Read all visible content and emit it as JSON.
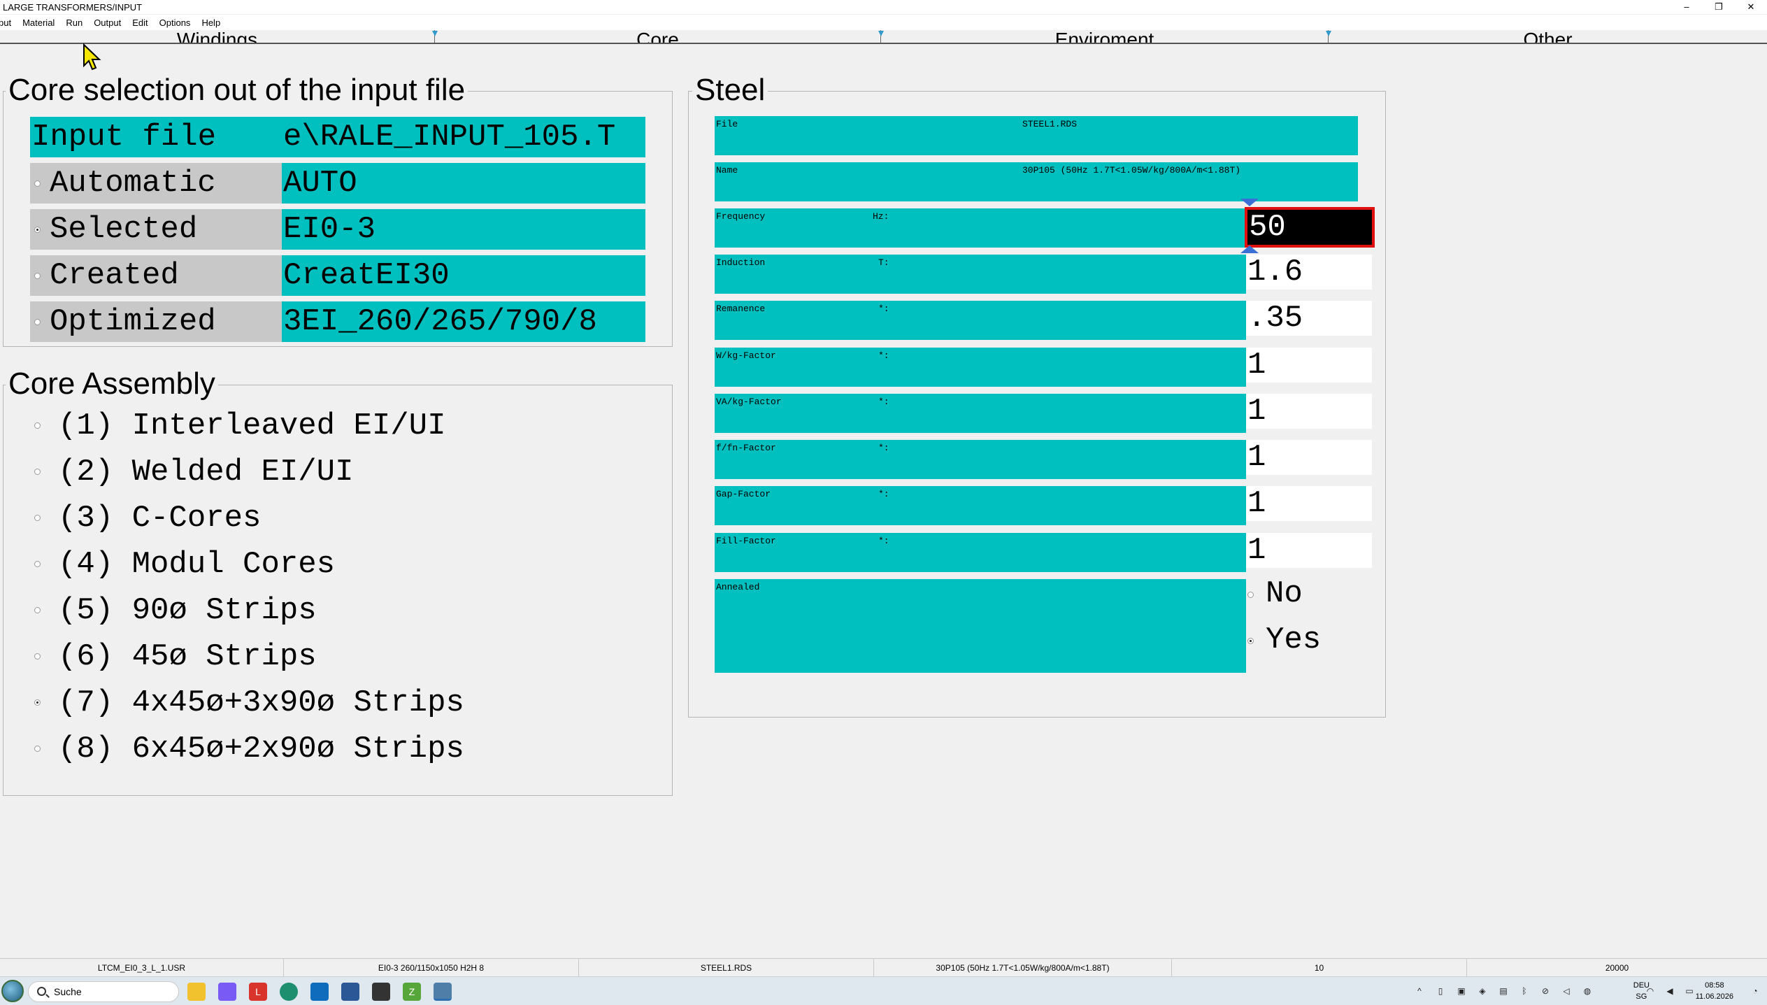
{
  "window": {
    "title": "LARGE TRANSFORMERS/INPUT",
    "minimize": "–",
    "restore": "❐",
    "close": "✕"
  },
  "menu": [
    "put",
    "Material",
    "Run",
    "Output",
    "Edit",
    "Options",
    "Help"
  ],
  "tabs": [
    "Windings",
    "Core",
    "Enviroment",
    "Other"
  ],
  "core_selection": {
    "title": "Core selection out of the input file",
    "input_file_label": "Input file",
    "input_file_value": "e\\RALE_INPUT_105.T",
    "rows": [
      {
        "label": "Automatic",
        "value": "AUTO",
        "selected": false
      },
      {
        "label": "Selected",
        "value": "EI0-3",
        "selected": true
      },
      {
        "label": "Created",
        "value": "CreatEI30",
        "selected": false
      },
      {
        "label": "Optimized",
        "value": "3EI_260/265/790/8",
        "selected": false
      }
    ]
  },
  "core_assembly": {
    "title": "Core Assembly",
    "items": [
      {
        "label": "(1)  Interleaved EI/UI",
        "selected": false
      },
      {
        "label": "(2)  Welded EI/UI",
        "selected": false
      },
      {
        "label": "(3)  C-Cores",
        "selected": false
      },
      {
        "label": "(4)  Modul Cores",
        "selected": false
      },
      {
        "label": "(5)  90ø Strips",
        "selected": false
      },
      {
        "label": "(6)  45ø Strips",
        "selected": false
      },
      {
        "label": "(7)  4x45ø+3x90ø Strips",
        "selected": true
      },
      {
        "label": "(8)  6x45ø+2x90ø Strips",
        "selected": false
      }
    ]
  },
  "steel": {
    "title": "Steel",
    "file_label": "File",
    "file_value": "STEEL1.RDS",
    "name_label": "Name",
    "name_value": "30P105 (50Hz 1.7T<1.05W/kg/800A/m<1.88T)",
    "fields": [
      {
        "label": "Frequency",
        "unit": "Hz:",
        "value": "50",
        "active": true
      },
      {
        "label": "Induction",
        "unit": "T:",
        "value": "1.6",
        "active": false
      },
      {
        "label": "Remanence",
        "unit": "*:",
        "value": ".35",
        "active": false
      },
      {
        "label": "W/kg-Factor",
        "unit": "*:",
        "value": "1",
        "active": false
      },
      {
        "label": "VA/kg-Factor",
        "unit": "*:",
        "value": "1",
        "active": false
      },
      {
        "label": "f/fn-Factor",
        "unit": "*:",
        "value": "1",
        "active": false
      },
      {
        "label": "Gap-Factor",
        "unit": "*:",
        "value": "1",
        "active": false
      },
      {
        "label": "Fill-Factor",
        "unit": "*:",
        "value": "1",
        "active": false
      }
    ],
    "annealed_label": "Annealed",
    "annealed_options": [
      {
        "label": "No",
        "selected": false
      },
      {
        "label": "Yes",
        "selected": true
      }
    ]
  },
  "statusbar": [
    "LTCM_EI0_3_L_1.USR",
    "EI0-3 260/1150x1050 H2H 8",
    "STEEL1.RDS",
    "30P105 (50Hz 1.7T<1.05W/kg/800A/m<1.88T)",
    "10",
    "20000"
  ],
  "taskbar": {
    "search_placeholder": "Suche",
    "lang": "DEU",
    "lang_sub": "SG",
    "time": "08:58",
    "date": "11.06.2026",
    "apps": [
      {
        "name": "file-explorer",
        "color": "#f2c12e"
      },
      {
        "name": "copilot",
        "color": "#7a5af5"
      },
      {
        "name": "app-l",
        "color": "#d9342b",
        "glyph": "L"
      },
      {
        "name": "edge",
        "color": "#1d8f6e"
      },
      {
        "name": "outlook",
        "color": "#0f6cbd"
      },
      {
        "name": "store",
        "color": "#2b5797"
      },
      {
        "name": "app-disc",
        "color": "#333333"
      },
      {
        "name": "app-z",
        "color": "#57a639",
        "glyph": "Z"
      },
      {
        "name": "app-active",
        "color": "#4f7fa8"
      }
    ]
  }
}
